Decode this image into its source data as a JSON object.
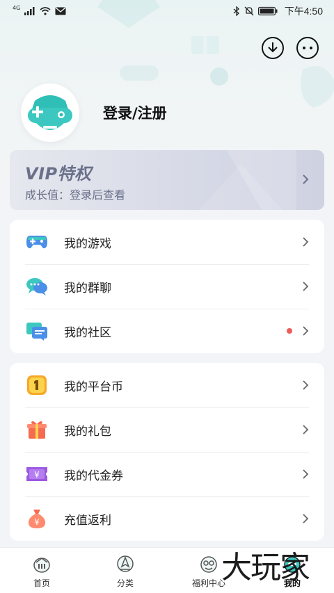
{
  "status_bar": {
    "network": "4G",
    "time": "下午4:50"
  },
  "header": {
    "download_icon": "download-icon",
    "message_icon": "message-icon"
  },
  "profile": {
    "login_label": "登录/注册",
    "avatar_icon": "gamepad-robot-avatar"
  },
  "vip": {
    "title": "VIP特权",
    "subtitle": "成长值：登录后查看"
  },
  "section1": {
    "items": [
      {
        "label": "我的游戏",
        "icon": "gamepad-icon",
        "dot": false
      },
      {
        "label": "我的群聊",
        "icon": "chat-bubbles-icon",
        "dot": false
      },
      {
        "label": "我的社区",
        "icon": "community-icon",
        "dot": true
      }
    ]
  },
  "section2": {
    "items": [
      {
        "label": "我的平台币",
        "icon": "coin-icon"
      },
      {
        "label": "我的礼包",
        "icon": "gift-icon"
      },
      {
        "label": "我的代金券",
        "icon": "voucher-icon"
      },
      {
        "label": "充值返利",
        "icon": "money-bag-icon"
      }
    ]
  },
  "tabbar": {
    "tabs": [
      {
        "label": "首页",
        "icon": "home-icon"
      },
      {
        "label": "分类",
        "icon": "category-icon"
      },
      {
        "label": "福利中心",
        "icon": "welfare-icon"
      },
      {
        "label": "我的",
        "icon": "profile-icon",
        "active": true
      }
    ]
  },
  "watermark": "大玩家",
  "colors": {
    "accent": "#3cc8c0",
    "vip_text": "#6b708a",
    "badge_dot": "#f05a5a"
  }
}
